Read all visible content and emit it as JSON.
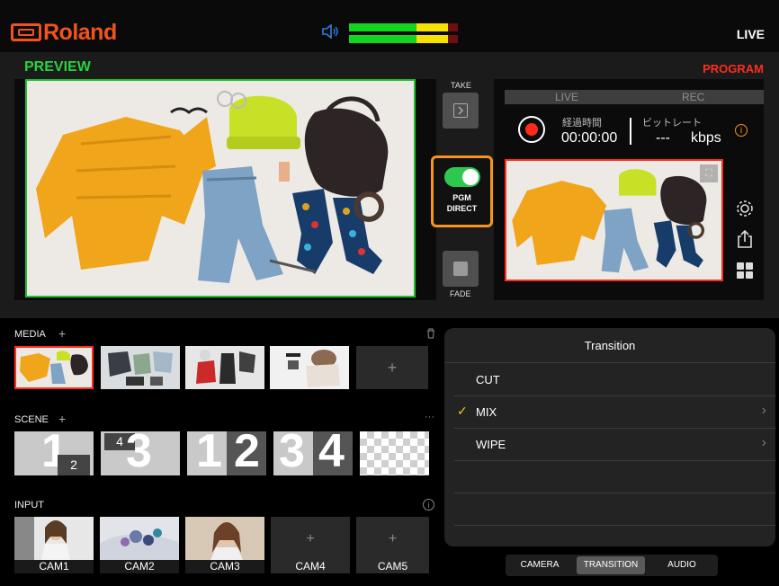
{
  "app": {
    "brand": "Roland",
    "live_status": "LIVE",
    "speaker_icon": "speaker-icon"
  },
  "audio_meter": {
    "channels": [
      {
        "level": 0.9,
        "peak_zone": "yellow"
      },
      {
        "level": 0.9,
        "peak_zone": "yellow"
      }
    ],
    "colors": {
      "green": "#12d61b",
      "yellow": "#f5e000",
      "red": "#6a1010"
    }
  },
  "preview": {
    "label": "PREVIEW",
    "label_color": "#28d23c",
    "border_color": "#1ec22a"
  },
  "controls": {
    "take_label": "TAKE",
    "pgm_direct_line1": "PGM",
    "pgm_direct_line2": "DIRECT",
    "pgm_direct_on": true,
    "fade_label": "FADE",
    "accent": "#f7931e"
  },
  "program": {
    "label": "PROGRAM",
    "label_color": "#ff2d1e",
    "status_live": "LIVE",
    "status_rec": "REC",
    "elapsed_label": "経過時間",
    "elapsed_value": "00:00:00",
    "bitrate_label": "ビットレート",
    "bitrate_value": "---",
    "bitrate_unit": "kbps",
    "info_icon": "info-icon",
    "side_icons": [
      "gear-icon",
      "share-icon",
      "grid-icon"
    ]
  },
  "media": {
    "label": "MEDIA",
    "add": "+",
    "items": [
      "media-1",
      "media-2",
      "media-3",
      "media-4"
    ],
    "add_tile": "+"
  },
  "scene": {
    "label": "SCENE",
    "add": "+",
    "more": "···",
    "tiles": [
      {
        "big": "1",
        "small": "2"
      },
      {
        "big": "3",
        "small": "4"
      },
      {
        "left": "1",
        "right": "2"
      },
      {
        "left": "3",
        "right": "4"
      },
      {
        "big": "",
        "small": ""
      }
    ]
  },
  "input": {
    "label": "INPUT",
    "cams": [
      {
        "label": "CAM1",
        "filled": true
      },
      {
        "label": "CAM2",
        "filled": true
      },
      {
        "label": "CAM3",
        "filled": true
      },
      {
        "label": "CAM4",
        "filled": false,
        "add": "+"
      },
      {
        "label": "CAM5",
        "filled": false,
        "add": "+"
      }
    ]
  },
  "transition": {
    "title": "Transition",
    "options": [
      {
        "label": "CUT",
        "selected": false,
        "has_chevron": false
      },
      {
        "label": "MIX",
        "selected": true,
        "has_chevron": true
      },
      {
        "label": "WIPE",
        "selected": false,
        "has_chevron": true
      }
    ],
    "check_mark": "✓",
    "chevron": "›"
  },
  "bottom_tabs": [
    {
      "label": "CAMERA",
      "active": false
    },
    {
      "label": "TRANSITION",
      "active": true
    },
    {
      "label": "AUDIO",
      "active": false
    }
  ]
}
